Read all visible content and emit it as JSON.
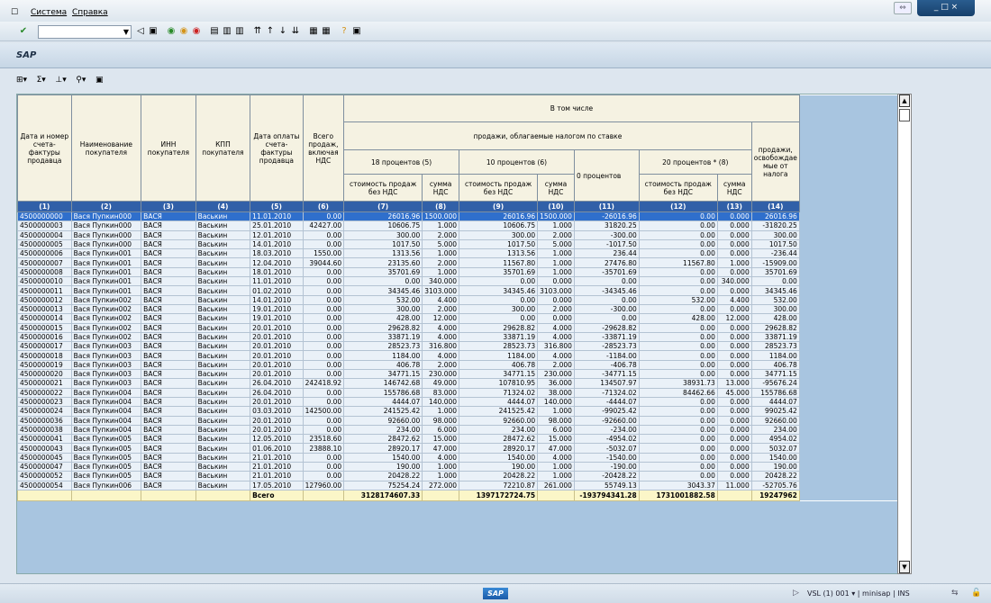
{
  "menu": {
    "system": "Система",
    "help": "Справка"
  },
  "toolbar": {
    "command_placeholder": ""
  },
  "app": {
    "title": "SAP"
  },
  "headers": {
    "h1": "Дата и номер счета-фактуры продавца",
    "h2": "Наименование покупателя",
    "h3": "ИНН покупателя",
    "h4": "КПП покупателя",
    "h5": "Дата оплаты счета-фактуры продавца",
    "h6": "Всего продаж, включая НДС",
    "incl": "В том числе",
    "taxed": "продажи, облагаемые налогом по ставке",
    "p18": "18 процентов (5)",
    "p10": "10 процентов (6)",
    "p0": "0 процентов",
    "p20": "20 процентов * (8)",
    "h14": "продажи, освобождае мые от налога",
    "costnovat": "стоимость продаж без НДС",
    "vatsum": "сумма НДС",
    "n": [
      "(1)",
      "(2)",
      "(3)",
      "(4)",
      "(5)",
      "(6)",
      "(7)",
      "(8)",
      "(9)",
      "(10)",
      "(11)",
      "(12)",
      "(13)",
      "(14)"
    ]
  },
  "rows": [
    [
      "4500000000",
      "Вася Пупкин000",
      "ВАСЯ",
      "Васькин",
      "11.01.2010",
      "0.00",
      "26016.96",
      "1500.000",
      "26016.96",
      "1500.000",
      "-26016.96",
      "0.00",
      "0.000",
      "26016.96"
    ],
    [
      "4500000003",
      "Вася Пупкин000",
      "ВАСЯ",
      "Васькин",
      "25.01.2010",
      "42427.00",
      "10606.75",
      "1.000",
      "10606.75",
      "1.000",
      "31820.25",
      "0.00",
      "0.000",
      "-31820.25"
    ],
    [
      "4500000004",
      "Вася Пупкин000",
      "ВАСЯ",
      "Васькин",
      "12.01.2010",
      "0.00",
      "300.00",
      "2.000",
      "300.00",
      "2.000",
      "-300.00",
      "0.00",
      "0.000",
      "300.00"
    ],
    [
      "4500000005",
      "Вася Пупкин000",
      "ВАСЯ",
      "Васькин",
      "14.01.2010",
      "0.00",
      "1017.50",
      "5.000",
      "1017.50",
      "5.000",
      "-1017.50",
      "0.00",
      "0.000",
      "1017.50"
    ],
    [
      "4500000006",
      "Вася Пупкин001",
      "ВАСЯ",
      "Васькин",
      "18.03.2010",
      "1550.00",
      "1313.56",
      "1.000",
      "1313.56",
      "1.000",
      "236.44",
      "0.00",
      "0.000",
      "-236.44"
    ],
    [
      "4500000007",
      "Вася Пупкин001",
      "ВАСЯ",
      "Васькин",
      "12.04.2010",
      "39044.60",
      "23135.60",
      "2.000",
      "11567.80",
      "1.000",
      "27476.80",
      "11567.80",
      "1.000",
      "-15909.00"
    ],
    [
      "4500000008",
      "Вася Пупкин001",
      "ВАСЯ",
      "Васькин",
      "18.01.2010",
      "0.00",
      "35701.69",
      "1.000",
      "35701.69",
      "1.000",
      "-35701.69",
      "0.00",
      "0.000",
      "35701.69"
    ],
    [
      "4500000010",
      "Вася Пупкин001",
      "ВАСЯ",
      "Васькин",
      "11.01.2010",
      "0.00",
      "0.00",
      "340.000",
      "0.00",
      "0.000",
      "0.00",
      "0.00",
      "340.000",
      "0.00"
    ],
    [
      "4500000011",
      "Вася Пупкин001",
      "ВАСЯ",
      "Васькин",
      "01.02.2010",
      "0.00",
      "34345.46",
      "3103.000",
      "34345.46",
      "3103.000",
      "-34345.46",
      "0.00",
      "0.000",
      "34345.46"
    ],
    [
      "4500000012",
      "Вася Пупкин002",
      "ВАСЯ",
      "Васькин",
      "14.01.2010",
      "0.00",
      "532.00",
      "4.400",
      "0.00",
      "0.000",
      "0.00",
      "532.00",
      "4.400",
      "532.00"
    ],
    [
      "4500000013",
      "Вася Пупкин002",
      "ВАСЯ",
      "Васькин",
      "19.01.2010",
      "0.00",
      "300.00",
      "2.000",
      "300.00",
      "2.000",
      "-300.00",
      "0.00",
      "0.000",
      "300.00"
    ],
    [
      "4500000014",
      "Вася Пупкин002",
      "ВАСЯ",
      "Васькин",
      "19.01.2010",
      "0.00",
      "428.00",
      "12.000",
      "0.00",
      "0.000",
      "0.00",
      "428.00",
      "12.000",
      "428.00"
    ],
    [
      "4500000015",
      "Вася Пупкин002",
      "ВАСЯ",
      "Васькин",
      "20.01.2010",
      "0.00",
      "29628.82",
      "4.000",
      "29628.82",
      "4.000",
      "-29628.82",
      "0.00",
      "0.000",
      "29628.82"
    ],
    [
      "4500000016",
      "Вася Пупкин002",
      "ВАСЯ",
      "Васькин",
      "20.01.2010",
      "0.00",
      "33871.19",
      "4.000",
      "33871.19",
      "4.000",
      "-33871.19",
      "0.00",
      "0.000",
      "33871.19"
    ],
    [
      "4500000017",
      "Вася Пупкин003",
      "ВАСЯ",
      "Васькин",
      "20.01.2010",
      "0.00",
      "28523.73",
      "316.800",
      "28523.73",
      "316.800",
      "-28523.73",
      "0.00",
      "0.000",
      "28523.73"
    ],
    [
      "4500000018",
      "Вася Пупкин003",
      "ВАСЯ",
      "Васькин",
      "20.01.2010",
      "0.00",
      "1184.00",
      "4.000",
      "1184.00",
      "4.000",
      "-1184.00",
      "0.00",
      "0.000",
      "1184.00"
    ],
    [
      "4500000019",
      "Вася Пупкин003",
      "ВАСЯ",
      "Васькин",
      "20.01.2010",
      "0.00",
      "406.78",
      "2.000",
      "406.78",
      "2.000",
      "-406.78",
      "0.00",
      "0.000",
      "406.78"
    ],
    [
      "4500000020",
      "Вася Пупкин003",
      "ВАСЯ",
      "Васькин",
      "20.01.2010",
      "0.00",
      "34771.15",
      "230.000",
      "34771.15",
      "230.000",
      "-34771.15",
      "0.00",
      "0.000",
      "34771.15"
    ],
    [
      "4500000021",
      "Вася Пупкин003",
      "ВАСЯ",
      "Васькин",
      "26.04.2010",
      "242418.92",
      "146742.68",
      "49.000",
      "107810.95",
      "36.000",
      "134507.97",
      "38931.73",
      "13.000",
      "-95676.24"
    ],
    [
      "4500000022",
      "Вася Пупкин004",
      "ВАСЯ",
      "Васькин",
      "26.04.2010",
      "0.00",
      "155786.68",
      "83.000",
      "71324.02",
      "38.000",
      "-71324.02",
      "84462.66",
      "45.000",
      "155786.68"
    ],
    [
      "4500000023",
      "Вася Пупкин004",
      "ВАСЯ",
      "Васькин",
      "20.01.2010",
      "0.00",
      "4444.07",
      "140.000",
      "4444.07",
      "140.000",
      "-4444.07",
      "0.00",
      "0.000",
      "4444.07"
    ],
    [
      "4500000024",
      "Вася Пупкин004",
      "ВАСЯ",
      "Васькин",
      "03.03.2010",
      "142500.00",
      "241525.42",
      "1.000",
      "241525.42",
      "1.000",
      "-99025.42",
      "0.00",
      "0.000",
      "99025.42"
    ],
    [
      "4500000036",
      "Вася Пупкин004",
      "ВАСЯ",
      "Васькин",
      "20.01.2010",
      "0.00",
      "92660.00",
      "98.000",
      "92660.00",
      "98.000",
      "-92660.00",
      "0.00",
      "0.000",
      "92660.00"
    ],
    [
      "4500000038",
      "Вася Пупкин004",
      "ВАСЯ",
      "Васькин",
      "20.01.2010",
      "0.00",
      "234.00",
      "6.000",
      "234.00",
      "6.000",
      "-234.00",
      "0.00",
      "0.000",
      "234.00"
    ],
    [
      "4500000041",
      "Вася Пупкин005",
      "ВАСЯ",
      "Васькин",
      "12.05.2010",
      "23518.60",
      "28472.62",
      "15.000",
      "28472.62",
      "15.000",
      "-4954.02",
      "0.00",
      "0.000",
      "4954.02"
    ],
    [
      "4500000043",
      "Вася Пупкин005",
      "ВАСЯ",
      "Васькин",
      "01.06.2010",
      "23888.10",
      "28920.17",
      "47.000",
      "28920.17",
      "47.000",
      "-5032.07",
      "0.00",
      "0.000",
      "5032.07"
    ],
    [
      "4500000045",
      "Вася Пупкин005",
      "ВАСЯ",
      "Васькин",
      "21.01.2010",
      "0.00",
      "1540.00",
      "4.000",
      "1540.00",
      "4.000",
      "-1540.00",
      "0.00",
      "0.000",
      "1540.00"
    ],
    [
      "4500000047",
      "Вася Пупкин005",
      "ВАСЯ",
      "Васькин",
      "21.01.2010",
      "0.00",
      "190.00",
      "1.000",
      "190.00",
      "1.000",
      "-190.00",
      "0.00",
      "0.000",
      "190.00"
    ],
    [
      "4500000052",
      "Вася Пупкин005",
      "ВАСЯ",
      "Васькин",
      "21.01.2010",
      "0.00",
      "20428.22",
      "1.000",
      "20428.22",
      "1.000",
      "-20428.22",
      "0.00",
      "0.000",
      "20428.22"
    ],
    [
      "4500000054",
      "Вася Пупкин006",
      "ВАСЯ",
      "Васькин",
      "17.05.2010",
      "127960.00",
      "75254.24",
      "272.000",
      "72210.87",
      "261.000",
      "55749.13",
      "3043.37",
      "11.000",
      "-52705.76"
    ]
  ],
  "totals": {
    "label": "Всего",
    "c7": "3128174607.33",
    "c9": "1397172724.75",
    "c11": "-193794341.28",
    "c12": "1731001882.58",
    "c14": "19247962"
  },
  "status": {
    "system_info": "VSL (1) 001",
    "server": "minisap",
    "mode": "INS"
  }
}
